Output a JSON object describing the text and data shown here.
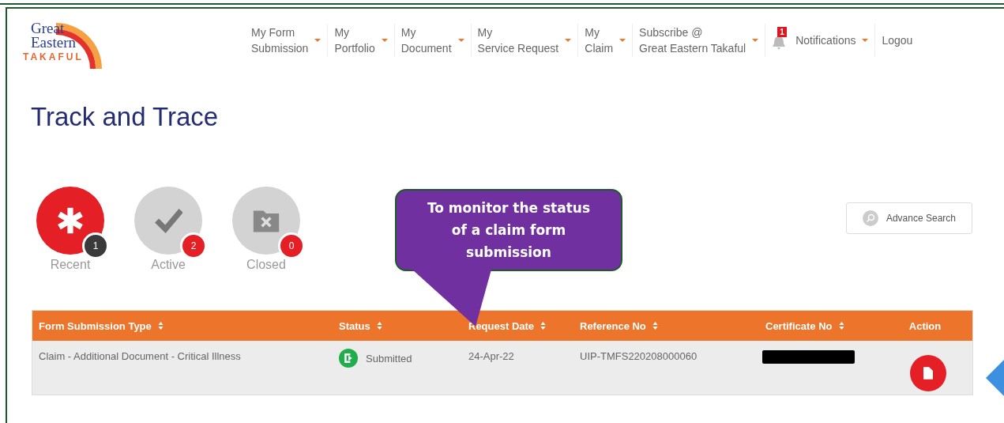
{
  "logo": {
    "line_1": "Great",
    "line_2": "Eastern",
    "line_3": "TAKAFUL"
  },
  "nav": [
    {
      "kind": "menu",
      "label": "My Form\nSubmission"
    },
    {
      "kind": "menu",
      "label": "My\nPortfolio"
    },
    {
      "kind": "menu",
      "label": "My\nDocument"
    },
    {
      "kind": "menu",
      "label": "My\nService Request"
    },
    {
      "kind": "menu",
      "label": "My\nClaim"
    },
    {
      "kind": "menu",
      "label": "Subscribe @\nGreat Eastern Takaful"
    },
    {
      "kind": "notifications",
      "label": "Notifications",
      "badge": "1"
    },
    {
      "kind": "link",
      "label": "Logou"
    }
  ],
  "page_title": "Track and Trace",
  "tiles": [
    {
      "kind": "recent",
      "label": "Recent",
      "count": "1",
      "selected": true
    },
    {
      "kind": "active",
      "label": "Active",
      "count": "2",
      "selected": false
    },
    {
      "kind": "closed",
      "label": "Closed",
      "count": "0",
      "selected": false
    }
  ],
  "advance_search": "Advance Search",
  "callout": "To  monitor the status of a claim form submission",
  "table": {
    "columns": [
      "Form Submission Type",
      "Status",
      "Request Date",
      "Reference No",
      "Certificate No",
      "Action"
    ],
    "sortable": [
      true,
      true,
      true,
      true,
      true,
      false
    ],
    "rows": [
      {
        "type": "Claim - Additional Document - Critical Illness",
        "status": "Submitted",
        "date": "24-Apr-22",
        "reference": "UIP-TMFS220208000060",
        "certificate_redacted": true
      }
    ]
  }
}
